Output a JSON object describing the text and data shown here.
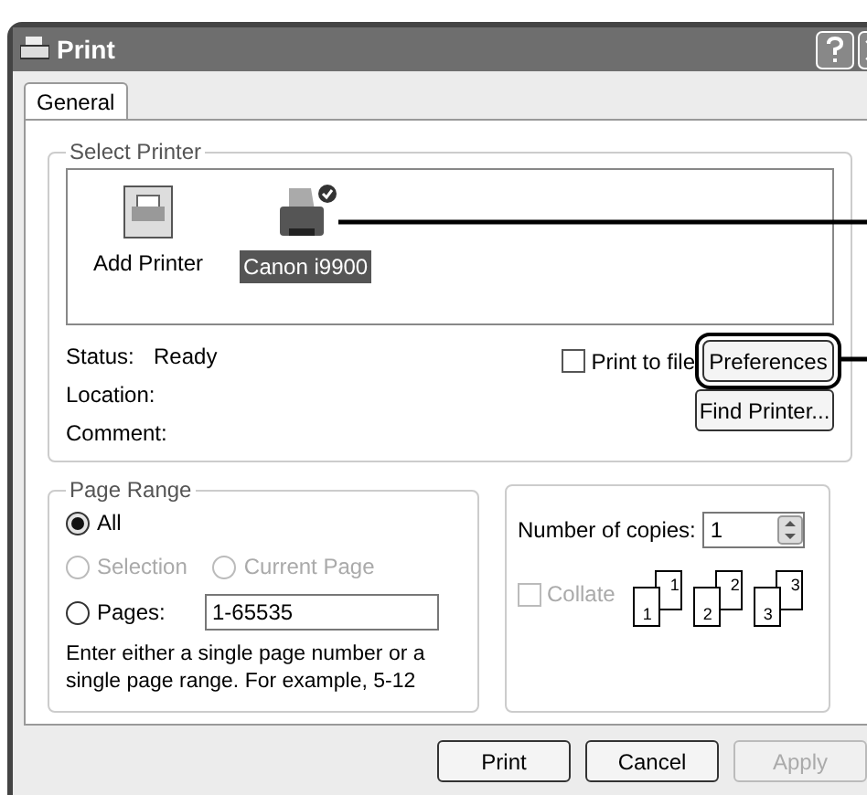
{
  "window": {
    "title": "Print"
  },
  "tabs": [
    {
      "label": "General",
      "selected": true
    }
  ],
  "select_printer": {
    "title": "Select Printer",
    "printers": [
      {
        "kind": "add",
        "name": "Add Printer",
        "selected": false
      },
      {
        "kind": "printer",
        "name": "Canon i9900",
        "selected": true
      }
    ],
    "status_label": "Status:",
    "status": "Ready",
    "location_label": "Location:",
    "comment_label": "Comment:",
    "print_to_file": {
      "label": "Print to file",
      "checked": false
    },
    "preferences_button": "Preferences",
    "find_printer_button": "Find Printer..."
  },
  "page_range": {
    "title": "Page Range",
    "options": [
      {
        "label": "All",
        "selected": true,
        "disabled": false
      },
      {
        "label": "Selection",
        "selected": false,
        "disabled": true
      },
      {
        "label": "Current Page",
        "selected": false,
        "disabled": true
      },
      {
        "label": "Pages:",
        "selected": false,
        "disabled": false
      }
    ],
    "pages_value": "1-65535",
    "hint": "Enter either a single page number or a single page range.  For example, 5-12"
  },
  "copies": {
    "label": "Number of copies:",
    "value": "1",
    "collate": {
      "label": "Collate",
      "checked": false,
      "disabled": true
    },
    "pages": [
      {
        "front": "1",
        "back": "1"
      },
      {
        "front": "2",
        "back": "2"
      },
      {
        "front": "3",
        "back": "3"
      }
    ]
  },
  "buttons": [
    {
      "label": "Print",
      "disabled": false
    },
    {
      "label": "Cancel",
      "disabled": false
    },
    {
      "label": "Apply",
      "disabled": true
    }
  ]
}
